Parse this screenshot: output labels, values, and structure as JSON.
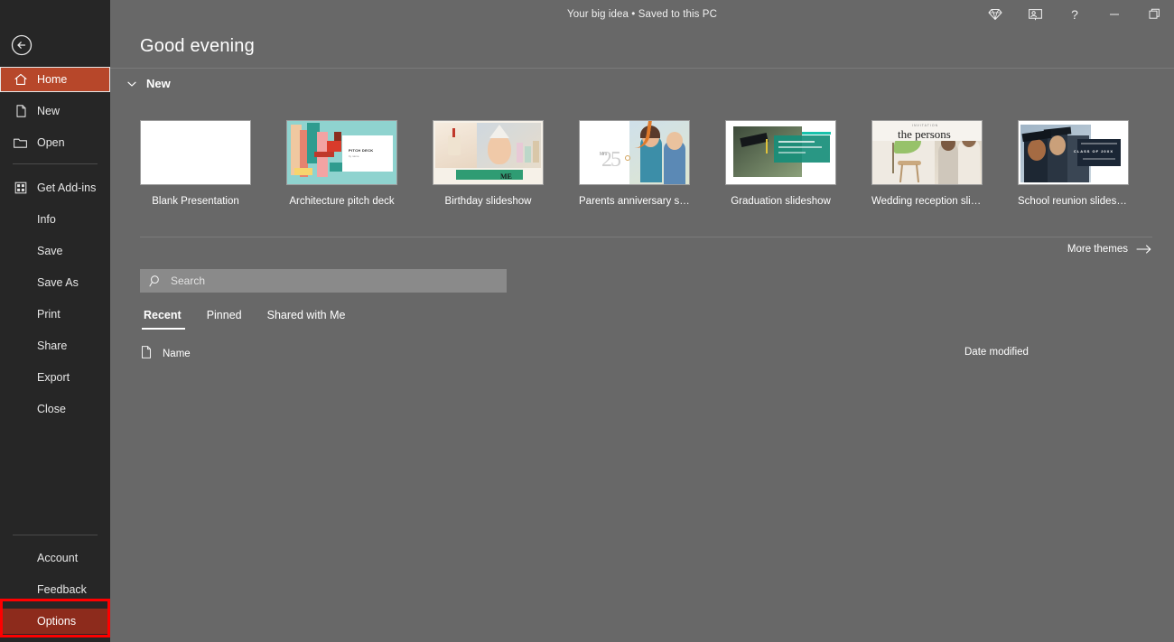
{
  "window": {
    "doc_title": "Your big idea  •  Saved to this PC",
    "controls": [
      {
        "name": "diamond-icon",
        "label": ""
      },
      {
        "name": "present-live-icon",
        "label": ""
      },
      {
        "name": "help-icon",
        "label": "?"
      },
      {
        "name": "minimize-icon",
        "label": ""
      },
      {
        "name": "restore-icon",
        "label": ""
      }
    ]
  },
  "sidebar": {
    "back_label": "Back",
    "items": [
      {
        "label": "Home",
        "icon": "home-icon",
        "state": "active"
      },
      {
        "label": "New",
        "icon": "new-file-icon",
        "state": "normal"
      },
      {
        "label": "Open",
        "icon": "folder-icon",
        "state": "normal"
      },
      {
        "label": "Get Add-ins",
        "icon": "addins-icon",
        "state": "normal"
      },
      {
        "label": "Info",
        "icon": "",
        "state": "normal"
      },
      {
        "label": "Save",
        "icon": "",
        "state": "normal"
      },
      {
        "label": "Save As",
        "icon": "",
        "state": "normal"
      },
      {
        "label": "Print",
        "icon": "",
        "state": "normal"
      },
      {
        "label": "Share",
        "icon": "",
        "state": "normal"
      },
      {
        "label": "Export",
        "icon": "",
        "state": "normal"
      },
      {
        "label": "Close",
        "icon": "",
        "state": "normal"
      }
    ],
    "bottom_items": [
      {
        "label": "Account",
        "state": "normal"
      },
      {
        "label": "Feedback",
        "state": "normal"
      },
      {
        "label": "Options",
        "state": "highlighted"
      }
    ]
  },
  "main": {
    "greeting": "Good evening",
    "new_section": {
      "label": "New",
      "expanded": true,
      "templates": [
        {
          "name": "Blank Presentation",
          "art": "blank"
        },
        {
          "name": "Architecture pitch deck",
          "art": "arch"
        },
        {
          "name": "Birthday slideshow",
          "art": "bday"
        },
        {
          "name": "Parents anniversary slidesh...",
          "art": "par"
        },
        {
          "name": "Graduation slideshow",
          "art": "grad"
        },
        {
          "name": "Wedding reception slideshow",
          "art": "wed"
        },
        {
          "name": "School reunion slideshow",
          "art": "sch"
        }
      ]
    },
    "more_themes": "More themes",
    "search": {
      "placeholder": "Search",
      "value": ""
    },
    "tabs": [
      {
        "label": "Recent",
        "active": true
      },
      {
        "label": "Pinned",
        "active": false
      },
      {
        "label": "Shared with Me",
        "active": false
      }
    ],
    "file_list": {
      "col_name": "Name",
      "col_date": "Date modified",
      "rows": []
    }
  },
  "thumb_text": {
    "arch_title": "PITCH DECK",
    "arch_sub": "by name",
    "bday_me": "ME",
    "wed_kicker": "INVITATION",
    "wed_title": "the persons",
    "sch_class": "CLASS OF 20XX"
  },
  "colors": {
    "sidebar_bg": "#262626",
    "content_bg": "#686868",
    "accent": "#b7472a",
    "annotation": "#fe0000",
    "options_fill": "#8d2b1c",
    "search_bg": "#8a8a8a"
  }
}
